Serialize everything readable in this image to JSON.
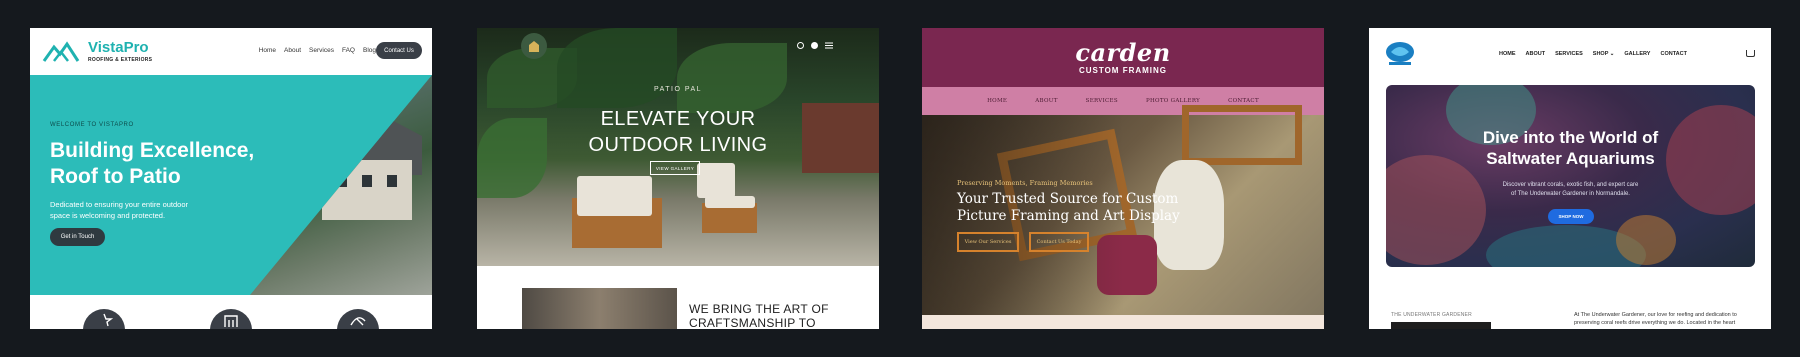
{
  "card1": {
    "brand": "VistaPro",
    "brand_sub": "ROOFING & EXTERIORS",
    "nav": [
      "Home",
      "About",
      "Services",
      "FAQ",
      "Blog"
    ],
    "contact": "Contact Us",
    "welcome": "WELCOME TO VISTAPRO",
    "headline": "Building Excellence, Roof to Patio",
    "tagline": "Dedicated to ensuring your entire outdoor space is welcoming and protected.",
    "cta": "Get in Touch",
    "accent": "#2cbcb9"
  },
  "card2": {
    "eyebrow": "PATIO PAL",
    "headline": "ELEVATE YOUR OUTDOOR LIVING",
    "cta": "VIEW GALLERY",
    "section_title": "WE BRING THE ART OF CRAFTSMANSHIP TO",
    "icons": [
      "instagram-icon",
      "facebook-icon",
      "menu-icon"
    ]
  },
  "card3": {
    "brand": "carden",
    "brand_sub": "CUSTOM FRAMING",
    "nav": [
      "HOME",
      "ABOUT",
      "SERVICES",
      "PHOTO GALLERY",
      "CONTACT"
    ],
    "eyebrow": "Preserving Moments, Framing Memories",
    "headline": "Your Trusted Source for Custom Picture Framing and Art Display",
    "cta1": "View Our Services",
    "cta2": "Contact Us Today",
    "accent": "#7a2750"
  },
  "card4": {
    "nav": [
      "HOME",
      "ABOUT",
      "SERVICES",
      "SHOP ⌄",
      "GALLERY",
      "CONTACT"
    ],
    "headline": "Dive into the World of Saltwater Aquariums",
    "subtext": "Discover vibrant corals, exotic fish, and expert care of The Underwater Gardener in Normandale.",
    "cta": "SHOP NOW",
    "tag": "THE UNDERWATER GARDENER",
    "paragraph": "At The Underwater Gardener, our love for reefing and dedication to preserving coral reefs drive everything we do. Located in the heart",
    "accent": "#1f6be0"
  }
}
